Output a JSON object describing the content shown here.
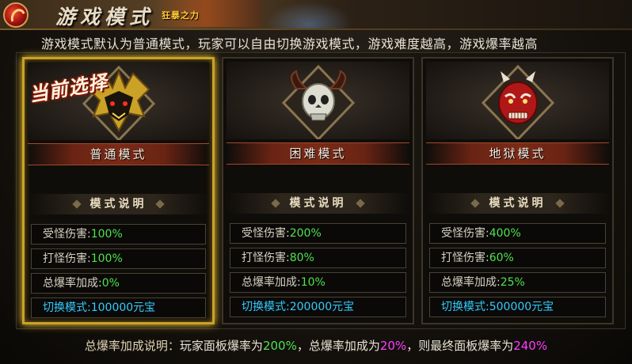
{
  "header": {
    "title": "游戏模式",
    "banner_sub": "狂暴之力"
  },
  "intro": "游戏模式默认为普通模式，玩家可以自由切换游戏模式，游戏难度越高，游戏爆率越高",
  "current_badge": "当前选择",
  "desc_title": "模式说明",
  "modes": [
    {
      "name": "普通模式",
      "selected": true,
      "emblem_icon": "golden-demon-helm-icon",
      "stats": [
        {
          "label": "受怪伤害:",
          "value": "100%"
        },
        {
          "label": "打怪伤害:",
          "value": "100%"
        },
        {
          "label": "总爆率加成:",
          "value": "0%"
        },
        {
          "label": "切换模式:",
          "value": "100000元宝"
        }
      ]
    },
    {
      "name": "困难模式",
      "selected": false,
      "emblem_icon": "horned-skull-icon",
      "stats": [
        {
          "label": "受怪伤害:",
          "value": "200%"
        },
        {
          "label": "打怪伤害:",
          "value": "80%"
        },
        {
          "label": "总爆率加成:",
          "value": "10%"
        },
        {
          "label": "切换模式:",
          "value": "200000元宝"
        }
      ]
    },
    {
      "name": "地狱模式",
      "selected": false,
      "emblem_icon": "red-oni-mask-icon",
      "stats": [
        {
          "label": "受怪伤害:",
          "value": "400%"
        },
        {
          "label": "打怪伤害:",
          "value": "60%"
        },
        {
          "label": "总爆率加成:",
          "value": "25%"
        },
        {
          "label": "切换模式:",
          "value": "500000元宝"
        }
      ]
    }
  ],
  "footer": {
    "label": "总爆率加成说明：",
    "t1": "玩家面板爆率为",
    "v1": "200%",
    "t2": "，总爆率加成为",
    "v2": "20%",
    "t3": "，则最终面板爆率为",
    "v3": "240%"
  },
  "colors": {
    "selected_border": "#c9a227",
    "value_green": "#4fe24f",
    "switch_cyan": "#33ccff",
    "highlight_magenta": "#ff3cff"
  }
}
